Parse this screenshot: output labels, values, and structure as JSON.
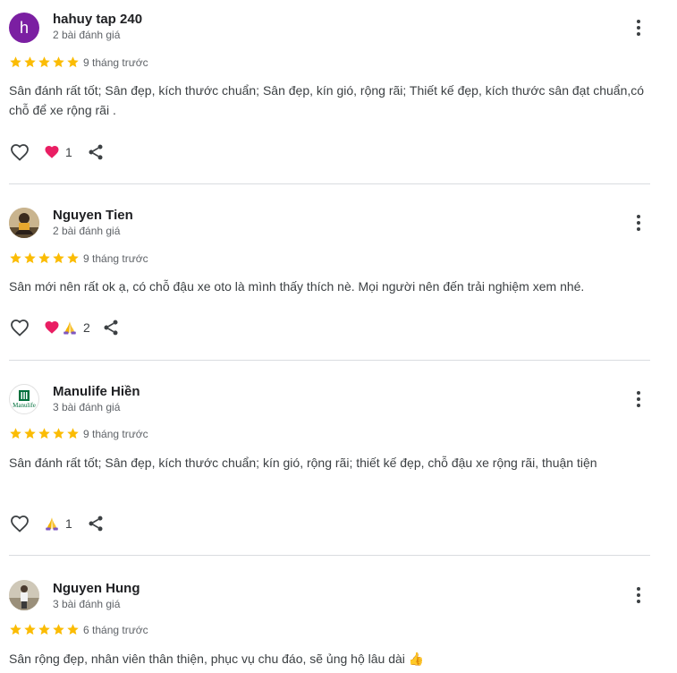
{
  "reviews": [
    {
      "name": "hahuy tap 240",
      "avatar_letter": "h",
      "review_count": "2 bài đánh giá",
      "rating": 5,
      "time": "9 tháng trước",
      "text": "Sân đánh rất tốt; Sân đẹp, kích thước chuẩn; Sân đẹp, kín gió, rộng rãi; Thiết kế đẹp, kích thước sân đạt chuẩn,có chỗ để xe rộng rãi .",
      "reactions": [
        "heart"
      ],
      "reaction_count": "1"
    },
    {
      "name": "Nguyen Tien",
      "avatar": "photo",
      "review_count": "2 bài đánh giá",
      "rating": 5,
      "time": "9 tháng trước",
      "text": "Sân mới nên rất ok ạ, có chỗ đậu xe oto là mình thấy thích nè. Mọi người nên đến trải nghiệm xem nhé.",
      "reactions": [
        "heart",
        "pray"
      ],
      "reaction_count": "2"
    },
    {
      "name": "Manulife Hiền",
      "avatar": "Manulife logo",
      "avatar_logo_text": "Manulife",
      "review_count": "3 bài đánh giá",
      "rating": 5,
      "time": "9 tháng trước",
      "text": "Sân đánh rất tốt; Sân đẹp, kích thước chuẩn; kín gió, rộng rãi; thiết kế đẹp, chỗ đậu xe rộng rãi, thuận tiện",
      "reactions": [
        "pray"
      ],
      "reaction_count": "1"
    },
    {
      "name": "Nguyen Hung",
      "avatar": "photo",
      "review_count": "3 bài đánh giá",
      "rating": 5,
      "time": "6 tháng trước",
      "text": "Sân rộng đẹp, nhân viên thân thiện, phục vụ chu đáo, sẽ ủng hộ lâu dài 👍",
      "reactions": [],
      "reaction_count": ""
    }
  ],
  "icons": {
    "more": "more-vert-icon",
    "like": "heart-outline-icon",
    "share": "share-icon",
    "star": "star-icon",
    "reaction_heart": "heart-reaction-icon",
    "reaction_pray": "pray-reaction-icon"
  },
  "colors": {
    "star": "#fbbc04",
    "avatar_letter_bg": "#7b1fa2",
    "divider": "#dadce0",
    "reaction_heart": "#e91e63"
  }
}
